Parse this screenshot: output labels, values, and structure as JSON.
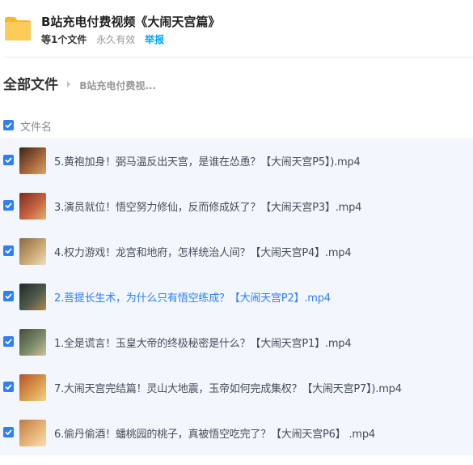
{
  "header": {
    "title": "B站充电付费视频《大闹天宫篇》",
    "count": "等1个文件",
    "expiry": "永久有效",
    "report": "举报"
  },
  "breadcrumb": {
    "root": "全部文件",
    "current": "B站充电付费视..."
  },
  "columns": {
    "filename": "文件名"
  },
  "files": [
    {
      "name": "5.黄袍加身！弼马温反出天宫，是谁在怂恿？【大闹天宫P5】).mp4",
      "checked": true,
      "thumb": [
        "#3a2418",
        "#a4643a",
        "#d8a56a"
      ]
    },
    {
      "name": "3.演员就位！悟空努力修仙，反而修成妖了？【大闹天宫P3】.mp4",
      "checked": true,
      "thumb": [
        "#7a2c22",
        "#c4623e",
        "#e2b070"
      ]
    },
    {
      "name": "4.权力游戏！龙宫和地府，怎样统治人间？【大闹天宫P4】.mp4",
      "checked": true,
      "thumb": [
        "#8a6a40",
        "#c8a872",
        "#ece0c2"
      ]
    },
    {
      "name": "2.菩提长生术，为什么只有悟空练成？【大闹天宫P2】.mp4",
      "checked": true,
      "thumb": [
        "#1f2a2a",
        "#4f5a4a",
        "#b08a50"
      ]
    },
    {
      "name": "1.全是谎言！玉皇大帝的终极秘密是什么？【大闹天宫P1】.mp4",
      "checked": true,
      "thumb": [
        "#4a4a3a",
        "#7a8a6a",
        "#d2c29a"
      ]
    },
    {
      "name": "7.大闹天宫完结篇！灵山大地震，玉帝如何完成集权？【大闹天宫P7】).mp4",
      "checked": true,
      "thumb": [
        "#b8502a",
        "#d89a4a",
        "#f2d28a"
      ]
    },
    {
      "name": "6.偷丹偷酒！蟠桃园的桃子，真被悟空吃完了？【大闹天宫P6】 .mp4",
      "checked": true,
      "thumb": [
        "#c07a40",
        "#e6b478",
        "#f6e0b0"
      ]
    }
  ],
  "colors": {
    "accent": "#2f7ff7",
    "row_bg": "#f3f6fd",
    "folder": "#f9c04c",
    "report": "#06a7ff"
  }
}
